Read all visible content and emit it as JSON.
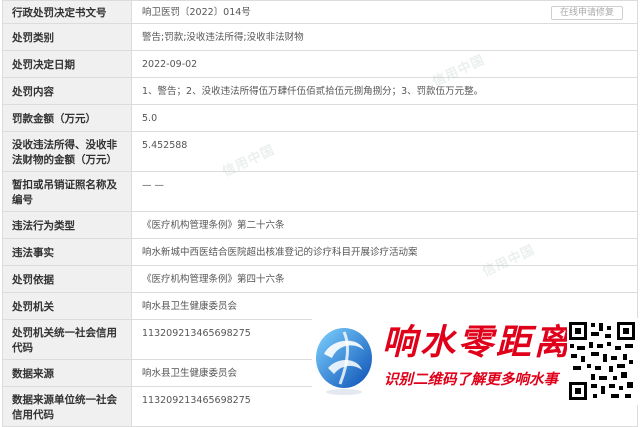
{
  "records": [
    {
      "label": "行政处罚决定书文号",
      "value": "响卫医罚〔2022〕014号"
    },
    {
      "label": "处罚类别",
      "value": "警告;罚款;没收违法所得;没收非法财物"
    },
    {
      "label": "处罚决定日期",
      "value": "2022-09-02"
    },
    {
      "label": "处罚内容",
      "value": "1、警告；2、没收违法所得伍万肆仟伍佰贰拾伍元捌角捌分；3、罚款伍万元整。"
    },
    {
      "label": "罚款金额（万元）",
      "value": "5.0"
    },
    {
      "label": "没收违法所得、没收非法财物的金额（万元）",
      "value": "5.452588"
    },
    {
      "label": "暂扣或吊销证照名称及编号",
      "value": "— —"
    },
    {
      "label": "违法行为类型",
      "value": "《医疗机构管理条例》第二十六条"
    },
    {
      "label": "违法事实",
      "value": "响水新城中西医结合医院超出核准登记的诊疗科目开展诊疗活动案"
    },
    {
      "label": "处罚依据",
      "value": "《医疗机构管理条例》第四十六条"
    },
    {
      "label": "处罚机关",
      "value": "响水县卫生健康委员会"
    },
    {
      "label": "处罚机关统一社会信用代码",
      "value": "113209213465698275"
    },
    {
      "label": "数据来源",
      "value": "响水县卫生健康委员会"
    },
    {
      "label": "数据来源单位统一社会信用代码",
      "value": "113209213465698275"
    }
  ],
  "fix_button": "在线申请修复",
  "watermark": "信用中国",
  "brand": {
    "title": "响水零距离",
    "subtitle": "识别二维码了解更多响水事",
    "logo_icon": "swirl-logo-icon",
    "qr_icon": "qr-code-icon",
    "accent": "#e0001a"
  }
}
